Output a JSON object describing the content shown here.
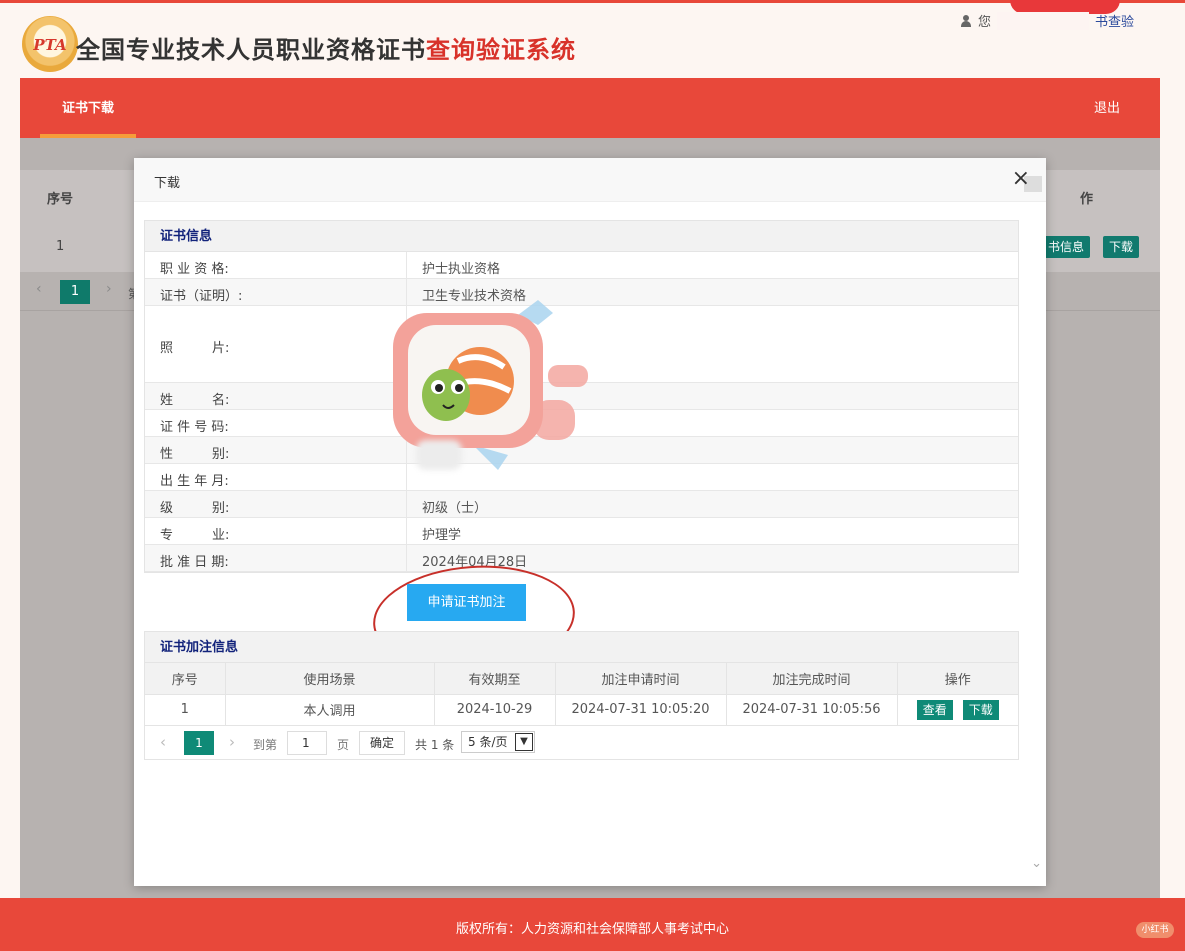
{
  "header": {
    "logo_text": "PTA",
    "title_main": "全国专业技术人员职业资格证书",
    "title_accent": "查询验证系统",
    "user_prefix": "您",
    "user_link": "书查验"
  },
  "nav": {
    "active_tab": "证书下载",
    "logout": "退出"
  },
  "background": {
    "col_no": "序号",
    "col_op": "作",
    "row_no": "1",
    "btn_info": "书信息",
    "btn_download": "下载",
    "pager_current": "1",
    "pager_text": "第"
  },
  "modal": {
    "title": "下载",
    "close": "×",
    "cert_section_title": "证书信息",
    "fields": [
      {
        "label": "职 业 资 格:",
        "value": "护士执业资格"
      },
      {
        "label": "证书（证明）:",
        "value": "卫生专业技术资格"
      },
      {
        "label": "照　　　片:",
        "value": ""
      },
      {
        "label": "姓　　　名:",
        "value": ""
      },
      {
        "label": "证 件 号 码:",
        "value": ""
      },
      {
        "label": "性　　　别:",
        "value": ""
      },
      {
        "label": "出 生 年 月:",
        "value": ""
      },
      {
        "label": "级　　　别:",
        "value": "初级（士）"
      },
      {
        "label": "专　　　业:",
        "value": "护理学"
      },
      {
        "label": "批 准 日 期:",
        "value": "2024年04月28日"
      }
    ],
    "apply_button": "申请证书加注",
    "annotation_section_title": "证书加注信息",
    "annotation_headers": [
      "序号",
      "使用场景",
      "有效期至",
      "加注申请时间",
      "加注完成时间",
      "操作"
    ],
    "annotation_rows": [
      {
        "no": "1",
        "scene": "本人调用",
        "valid_until": "2024-10-29",
        "apply_time": "2024-07-31 10:05:20",
        "complete_time": "2024-07-31 10:05:56",
        "view": "查看",
        "download": "下载"
      }
    ],
    "pager": {
      "current": "1",
      "goto_label": "到第",
      "goto_value": "1",
      "page_label": "页",
      "confirm": "确定",
      "total": "共 1 条",
      "page_size": "5 条/页"
    }
  },
  "footer": {
    "copyright": "版权所有：人力资源和社会保障部人事考试中心"
  },
  "watermark": "小红书"
}
